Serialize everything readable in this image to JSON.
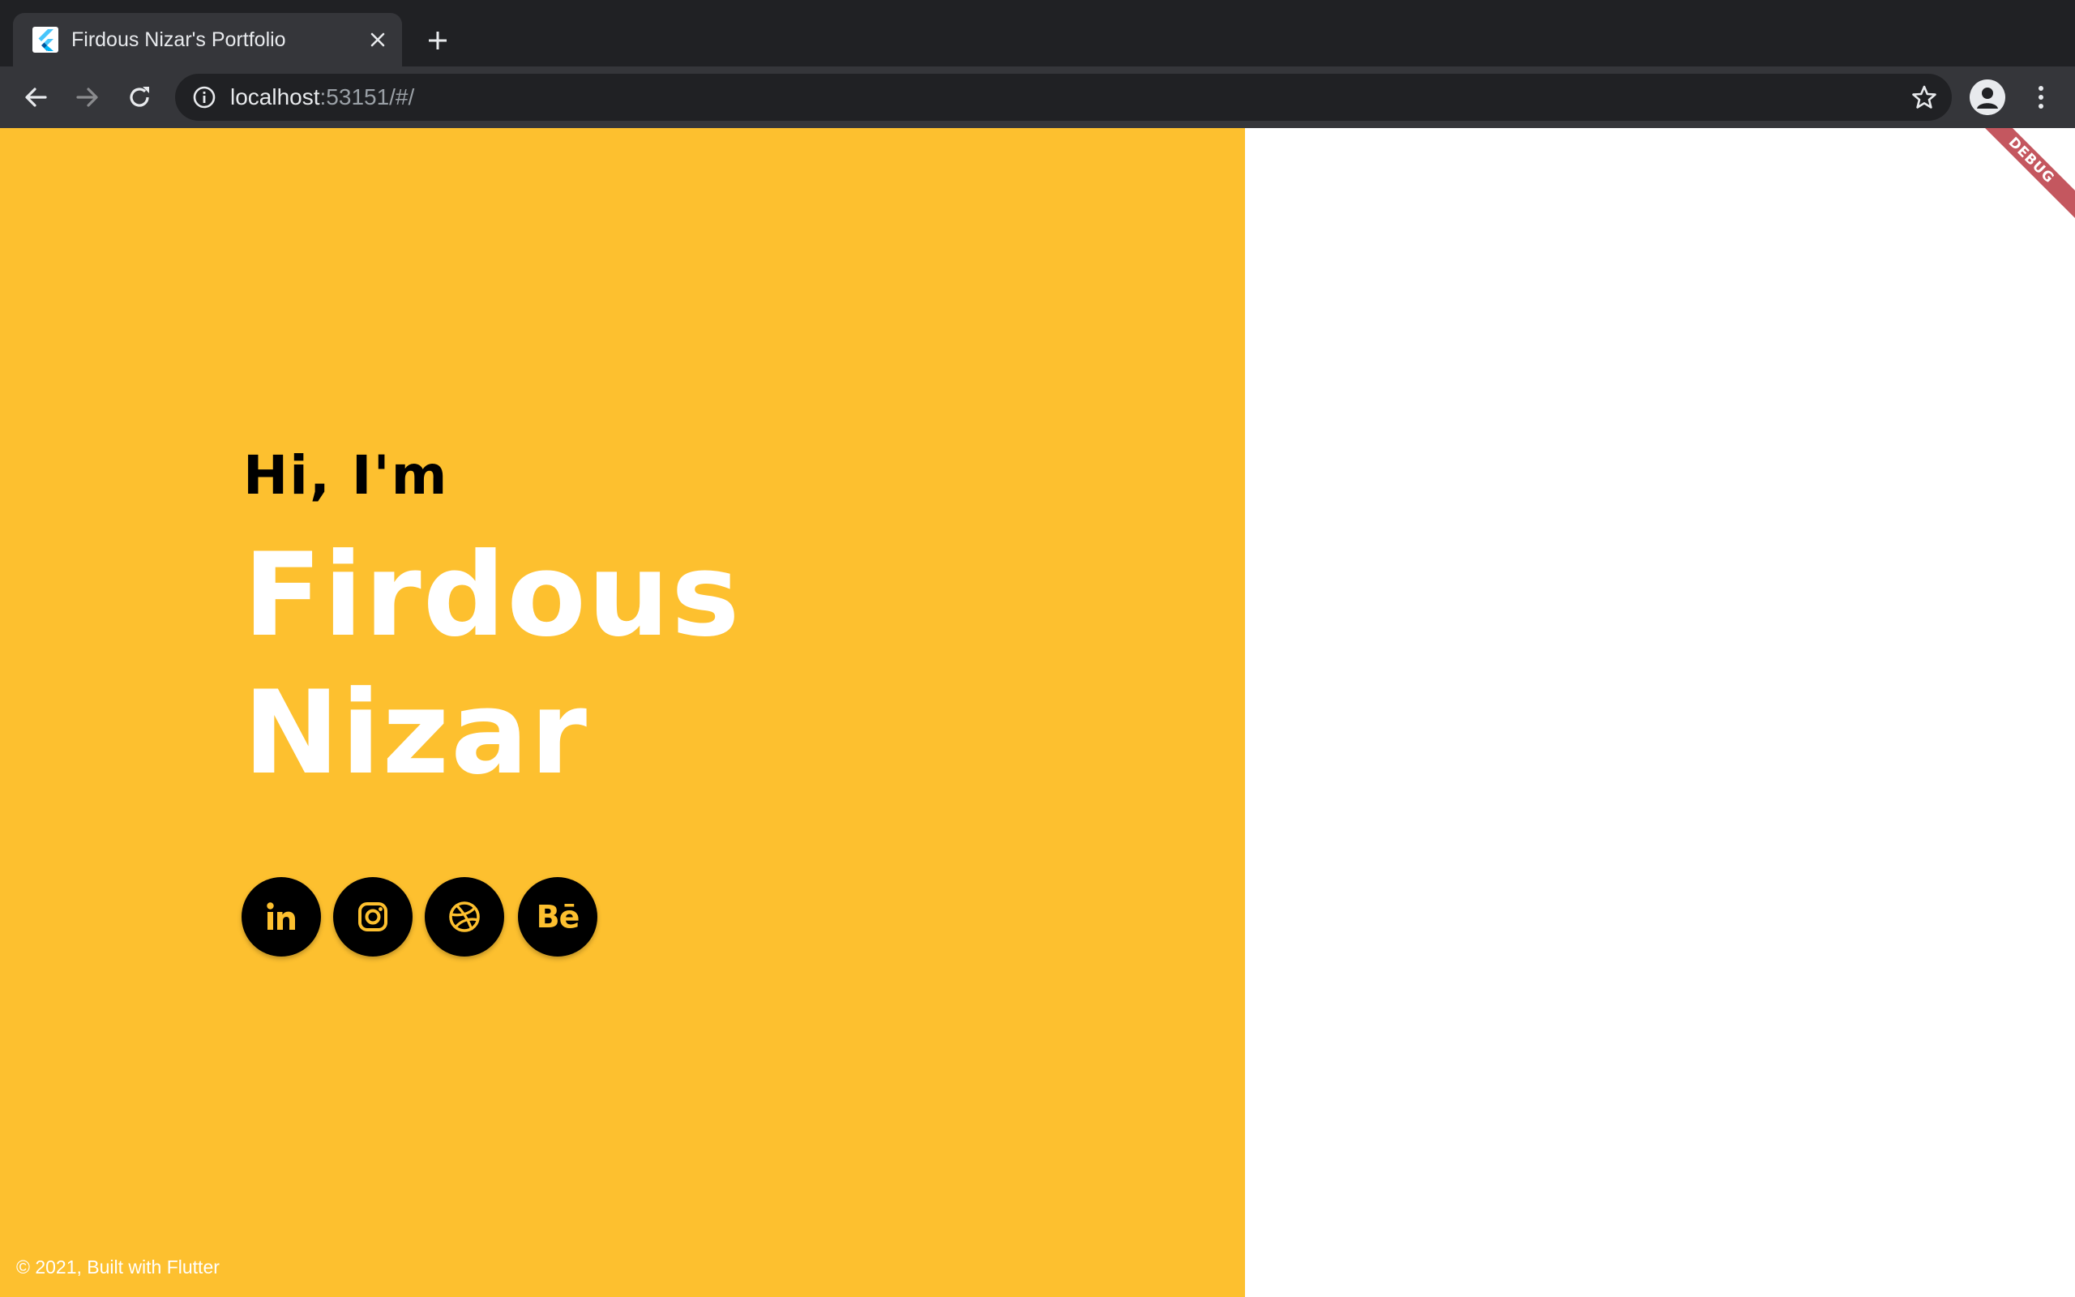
{
  "browser": {
    "tab": {
      "title": "Firdous Nizar's Portfolio",
      "favicon_icon": "flutter-logo-icon"
    },
    "new_tab_icon": "plus-icon",
    "toolbar": {
      "back_icon": "arrow-left-icon",
      "forward_icon": "arrow-right-icon",
      "reload_icon": "reload-icon",
      "address": {
        "host": "localhost",
        "path": ":53151/#/",
        "info_icon": "info-icon",
        "bookmark_icon": "star-icon"
      },
      "profile_icon": "person-icon",
      "menu_icon": "kebab-menu-icon"
    }
  },
  "page": {
    "colors": {
      "accent": "#fdc02f",
      "background_right": "#ffffff",
      "text_dark": "#000000",
      "text_light": "#ffffff"
    },
    "hero": {
      "greeting": "Hi, I'm",
      "name_first": "Firdous",
      "name_last": "Nizar"
    },
    "socials": [
      {
        "name": "LinkedIn",
        "icon": "linkedin-icon"
      },
      {
        "name": "Instagram",
        "icon": "instagram-icon"
      },
      {
        "name": "Dribbble",
        "icon": "dribbble-icon"
      },
      {
        "name": "Behance",
        "icon": "behance-icon",
        "label": "Bē"
      }
    ],
    "footer": "© 2021, Built with Flutter",
    "debug_banner": "DEBUG"
  }
}
